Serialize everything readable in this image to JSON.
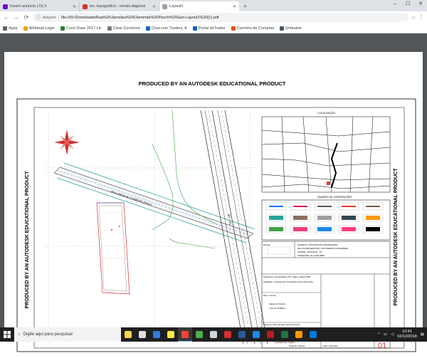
{
  "browser": {
    "tabs": [
      {
        "label": "Inserir anúncio | OLX",
        "color": "#6e0ad6"
      },
      {
        "label": "lev. topografico - renato.dagnoni",
        "color": "#d93025"
      },
      {
        "label": "Layout1",
        "color": "#5f6368"
      }
    ],
    "new_tab": "+",
    "window_controls": [
      "–",
      "☐",
      "✕"
    ],
    "nav": {
      "back": "←",
      "forward": "→",
      "reload": "⟳"
    },
    "address": {
      "chip": "Arquivo",
      "url": "file:///D:/Downloads/Rua%20Jaroslau%20Clemente%20Pesch%20Geo-Layout1%20(1).pdf"
    },
    "bookmarks": [
      {
        "label": "Apps",
        "color": "#5f6368"
      },
      {
        "label": "Webmail Login",
        "color": "#e0a800"
      },
      {
        "label": "Corel Draw 2017 Lic",
        "color": "#2e7d32"
      },
      {
        "label": "Clear Corretora",
        "color": "#777"
      },
      {
        "label": "Chat.com Traders, A",
        "color": "#1565c0"
      },
      {
        "label": "Portal doTrader",
        "color": "#1565c0"
      },
      {
        "label": "Carrinho de Compras",
        "color": "#e65100"
      },
      {
        "label": "Embalsio",
        "color": "#455a64"
      }
    ]
  },
  "drawing": {
    "header_text": "PRODUCED BY AN AUTODESK EDUCATIONAL PRODUCT",
    "side_text": "PRODUCED BY AN AUTODESK EDUCATIONAL PRODUCT",
    "localizacao_title": "LOCALIZAÇÃO",
    "convencoes_title": "QUADRO DE CONVENÇÕES",
    "convention_colors": [
      "#1a73e8",
      "#d81b60",
      "#555555",
      "#e53935",
      "#795548",
      "#26a69a",
      "#8d6e63",
      "#9e9e9e",
      "#37474f",
      "#ff9800",
      "#43a047",
      "#ec407a",
      "#1e88e5",
      "#ff4081",
      "#000000"
    ],
    "road_label": "RUA JAROSLAU CLEMENTE PESCH",
    "highway_label": "BR - 101",
    "company_lines": [
      "ANGELIN TOPOGRAFIA E ENGENHARIA",
      "RUA FLORIANOPOLIS, 1457 BAIRRO GUANABARA",
      "CIDADE: JOINVILLE - SC",
      "TELEFONE: (47) 3434-6806"
    ],
    "left_block": [
      "Referência: Coordenadas UTM - Datum: Sirgas 2000",
      "Finalidade: Levantamento Topográfico Georreferenciado",
      "Resp. Técnico:",
      "Angelo da Oliveira",
      "Crea-Sc 074695-3",
      "Endereço: Rua Jaroslau Clemente Pesch",
      "Bairro: Pirabeiraba Joinville/sc",
      "Escala 1:500",
      "Levantamento: Angelo",
      "Desenho: Samuel",
      "Data: maio/2014"
    ],
    "labels": {
      "escopo": "Escopo",
      "area": "Área terreno 370,00m²",
      "sheet_label": "Prancha",
      "sheet_num": "01"
    }
  },
  "taskbar": {
    "search_placeholder": "Digite aqui para pesquisar",
    "apps": [
      "#ffd54f",
      "#e0e0e0",
      "#2f7ed8",
      "#ffeb3b",
      "#f44336",
      "#4caf50",
      "#cfd8dc",
      "#d32f2f",
      "#2b579a",
      "#1e88e5",
      "#b71c1c",
      "#217346",
      "#ff9800",
      "#0078d7"
    ],
    "time": "10:41",
    "date": "02/12/2018"
  }
}
